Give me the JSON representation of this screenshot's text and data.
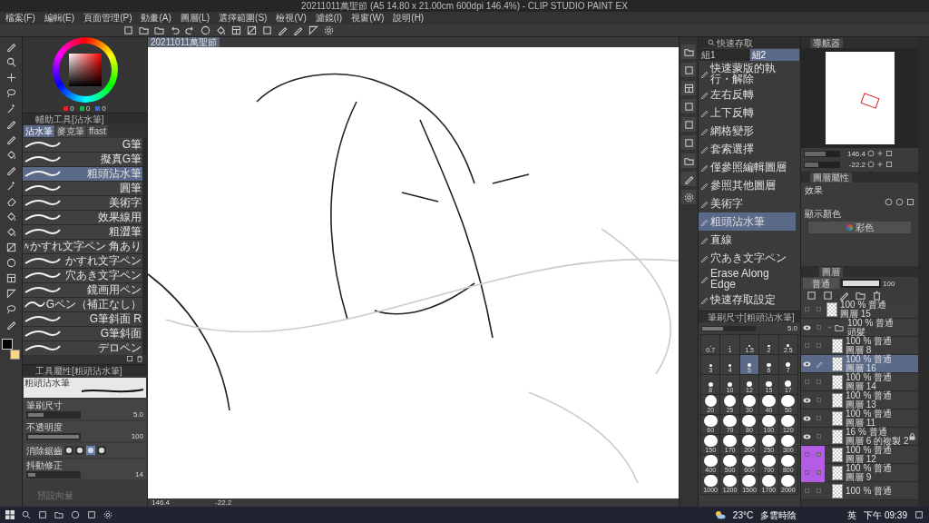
{
  "title_bar": {
    "title": "20211011萬聖節 (A5 14.80 x 21.00cm 600dpi 146.4%) - CLIP STUDIO PAINT EX"
  },
  "menu": [
    "檔案(F)",
    "編輯(E)",
    "頁面管理(P)",
    "動畫(A)",
    "圖層(L)",
    "選擇範圍(S)",
    "檢視(V)",
    "濾鏡(I)",
    "視窗(W)",
    "說明(H)"
  ],
  "color_panel": {
    "readings": [
      {
        "value": "0",
        "color": "#e02424"
      },
      {
        "value": "0",
        "color": "#22b04a"
      },
      {
        "value": "0",
        "color": "#2c6fe0"
      }
    ]
  },
  "sub_tool": {
    "title": "輔助工具[沾水筆]",
    "groups": [
      {
        "label": "沾水筆",
        "selected": true
      },
      {
        "label": "麥克筆",
        "selected": false
      },
      {
        "label": "ffast",
        "selected": false
      }
    ],
    "items": [
      {
        "label": "G筆",
        "selected": false
      },
      {
        "label": "擬真G筆",
        "selected": false
      },
      {
        "label": "粗頭沾水筆",
        "selected": true
      },
      {
        "label": "圓筆",
        "selected": false
      },
      {
        "label": "美術字",
        "selected": false
      },
      {
        "label": "效果線用",
        "selected": false
      },
      {
        "label": "粗澀筆",
        "selected": false
      },
      {
        "label": "かすれ文字ペン 角あり",
        "selected": false
      },
      {
        "label": "かすれ文字ペン",
        "selected": false
      },
      {
        "label": "穴あき文字ペン",
        "selected": false
      },
      {
        "label": "鏡画用ペン",
        "selected": false
      },
      {
        "label": "Gペン（補正なし）",
        "selected": false
      },
      {
        "label": "G筆斜面 R",
        "selected": false
      },
      {
        "label": "G筆斜面",
        "selected": false
      },
      {
        "label": "デロペン",
        "selected": false
      }
    ]
  },
  "tool_property": {
    "title": "工具屬性[粗頭沾水筆]",
    "preview_label": "粗頭沾水筆",
    "rows": [
      {
        "kind": "number",
        "label": "筆刷尺寸",
        "value": "5.0",
        "level": 0.3
      },
      {
        "kind": "number",
        "label": "不透明度",
        "value": "100",
        "level": 1
      },
      {
        "kind": "antialias",
        "label": "消除鋸齒",
        "options": [
          {
            "selected": false
          },
          {
            "selected": false
          },
          {
            "selected": true
          },
          {
            "selected": false
          }
        ]
      },
      {
        "kind": "number",
        "label": "抖動修正",
        "value": "14",
        "level": 0.14
      },
      {
        "kind": "disabled",
        "label": "預設向量"
      }
    ]
  },
  "canvas": {
    "tab": "20211011萬聖節",
    "zoom": "146.4",
    "angle": "-22.2"
  },
  "quick_access": {
    "title": "快速存取",
    "sets": [
      {
        "label": "組1",
        "selected": false
      },
      {
        "label": "組2",
        "selected": true
      }
    ],
    "items": [
      {
        "label": "快速蒙版的執行・解除",
        "selected": false
      },
      {
        "label": "左右反轉",
        "selected": false
      },
      {
        "label": "上下反轉",
        "selected": false
      },
      {
        "label": "網格變形",
        "selected": false
      },
      {
        "label": "套索選擇",
        "selected": false
      },
      {
        "label": "僅參照編輯圖層",
        "selected": false
      },
      {
        "label": "參照其他圖層",
        "selected": false
      },
      {
        "label": "美術字",
        "selected": false
      },
      {
        "label": "粗頭沾水筆",
        "selected": true
      },
      {
        "label": "直線",
        "selected": false
      },
      {
        "label": "穴あき文字ペン",
        "selected": false
      },
      {
        "label": "Erase Along Edge",
        "selected": false
      },
      {
        "label": "快速存取設定",
        "selected": false
      }
    ]
  },
  "brush_size": {
    "title": "筆刷尺寸[粗頭沾水筆]",
    "value": "5.0",
    "level": 0.4,
    "sizes": [
      {
        "label": "0.7",
        "selected": false
      },
      {
        "label": "1",
        "selected": false
      },
      {
        "label": "1.5",
        "selected": false
      },
      {
        "label": "2",
        "selected": false
      },
      {
        "label": "2.5",
        "selected": false
      },
      {
        "label": "3",
        "selected": false
      },
      {
        "label": "4",
        "selected": false
      },
      {
        "label": "5",
        "selected": true
      },
      {
        "label": "6",
        "selected": false
      },
      {
        "label": "7",
        "selected": false
      },
      {
        "label": "8",
        "selected": false
      },
      {
        "label": "10",
        "selected": false
      },
      {
        "label": "12",
        "selected": false
      },
      {
        "label": "15",
        "selected": false
      },
      {
        "label": "17",
        "selected": false
      },
      {
        "label": "20",
        "selected": false
      },
      {
        "label": "25",
        "selected": false
      },
      {
        "label": "30",
        "selected": false
      },
      {
        "label": "40",
        "selected": false
      },
      {
        "label": "50",
        "selected": false
      },
      {
        "label": "60",
        "selected": false
      },
      {
        "label": "70",
        "selected": false
      },
      {
        "label": "80",
        "selected": false
      },
      {
        "label": "100",
        "selected": false
      },
      {
        "label": "120",
        "selected": false
      },
      {
        "label": "150",
        "selected": false
      },
      {
        "label": "170",
        "selected": false
      },
      {
        "label": "200",
        "selected": false
      },
      {
        "label": "250",
        "selected": false
      },
      {
        "label": "300",
        "selected": false
      },
      {
        "label": "400",
        "selected": false
      },
      {
        "label": "500",
        "selected": false
      },
      {
        "label": "600",
        "selected": false
      },
      {
        "label": "700",
        "selected": false
      },
      {
        "label": "800",
        "selected": false
      },
      {
        "label": "1000",
        "selected": false
      },
      {
        "label": "1200",
        "selected": false
      },
      {
        "label": "1500",
        "selected": false
      },
      {
        "label": "1700",
        "selected": false
      },
      {
        "label": "2000",
        "selected": false
      }
    ]
  },
  "navigator": {
    "tab": "導航器",
    "zoom": "146.4",
    "zoom_slider": {
      "level": 0.6
    },
    "angle": "-22.2",
    "angle_slider": {
      "level": 0.4
    }
  },
  "layer_property": {
    "tab": "圖層屬性",
    "effect_label": "效果",
    "display_color_label": "顯示顏色",
    "display_color": "彩色"
  },
  "layers": {
    "tab": "圖層",
    "blend_mode": "普通",
    "opacity": "100",
    "opacity_slider": {
      "level": 1
    },
    "items": [
      {
        "kind": "layer",
        "mode": "100 % 普通",
        "name": "圖層 15",
        "visible": false,
        "editing": false,
        "selected": false,
        "locked": false
      },
      {
        "kind": "folder",
        "mode": "100 % 普通",
        "name": "頭髮",
        "visible": true,
        "editing": false,
        "selected": false,
        "locked": false,
        "expanded": true,
        "children": [
          {
            "kind": "layer",
            "mode": "100 % 普通",
            "name": "圖層 8",
            "visible": false,
            "editing": false,
            "selected": false,
            "locked": false
          },
          {
            "kind": "layer",
            "mode": "100 % 普通",
            "name": "圖層 16",
            "visible": true,
            "editing": true,
            "selected": true,
            "locked": false
          },
          {
            "kind": "layer",
            "mode": "100 % 普通",
            "name": "圖層 14",
            "visible": false,
            "editing": false,
            "selected": false,
            "locked": false
          },
          {
            "kind": "layer",
            "mode": "100 % 普通",
            "name": "圖層 13",
            "visible": true,
            "editing": false,
            "selected": false,
            "locked": false
          },
          {
            "kind": "layer",
            "mode": "100 % 普通",
            "name": "圖層 11",
            "visible": true,
            "editing": false,
            "selected": false,
            "locked": false
          },
          {
            "kind": "layer",
            "mode": "16 % 普通",
            "name": "圖層 6 的複製 2",
            "visible": true,
            "editing": false,
            "selected": false,
            "locked": true
          },
          {
            "kind": "layer",
            "mode": "100 % 普通",
            "name": "圖層 12",
            "visible": false,
            "editing": false,
            "selected": false,
            "locked": false,
            "color": "#b45ce6"
          },
          {
            "kind": "layer",
            "mode": "100 % 普通",
            "name": "圖層 9",
            "visible": false,
            "editing": false,
            "selected": false,
            "locked": false,
            "color": "#b45ce6"
          },
          {
            "kind": "layer",
            "mode": "100 % 普通",
            "visible": false,
            "editing": false,
            "selected": false,
            "locked": false
          }
        ]
      }
    ]
  },
  "taskbar": {
    "temperature": "23°C",
    "weather": "多雲時陰",
    "input_method": "英",
    "time": "下午 09:39"
  }
}
